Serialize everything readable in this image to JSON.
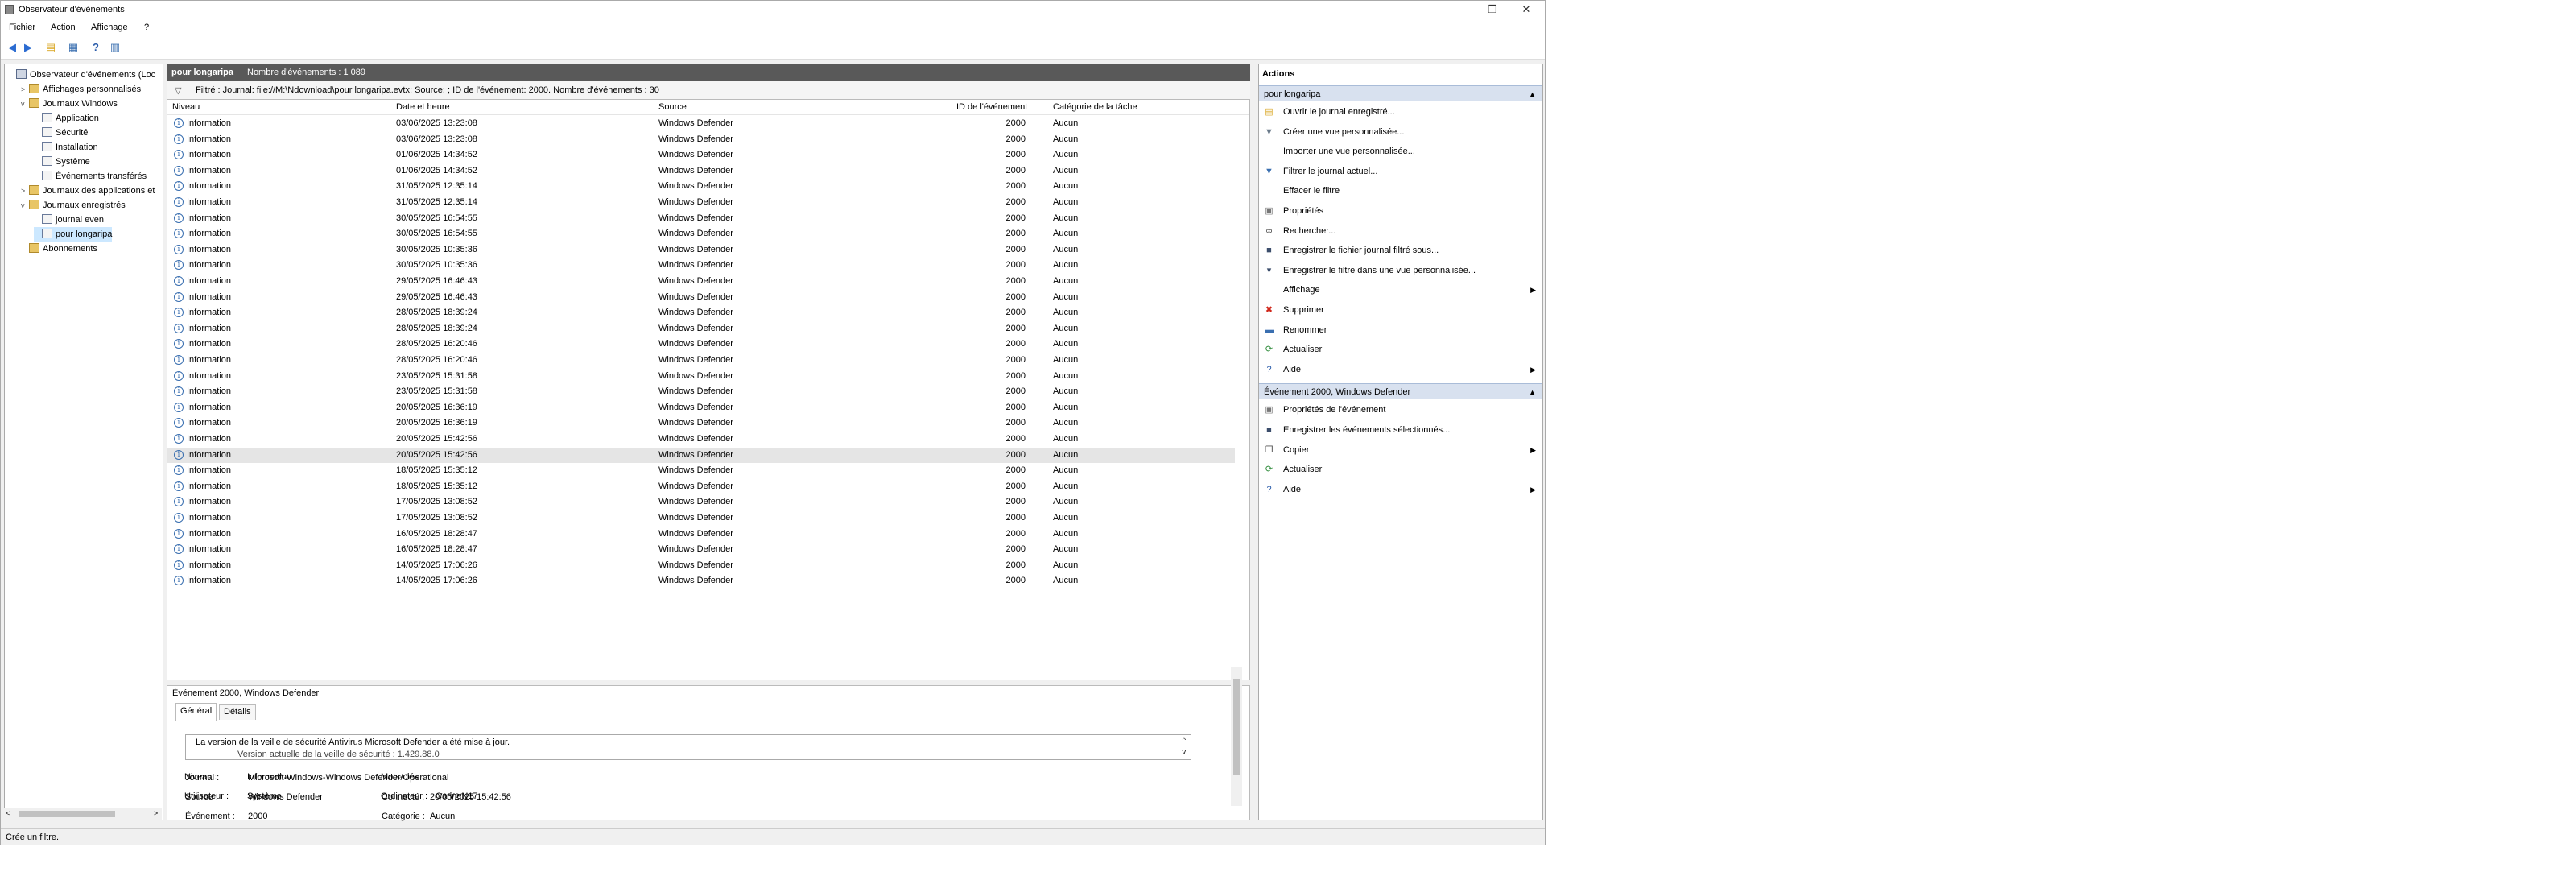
{
  "window": {
    "title": "Observateur d'événements"
  },
  "menu": [
    "Fichier",
    "Action",
    "Affichage",
    "?"
  ],
  "tree": [
    {
      "label": "Observateur d'événements (Loc",
      "level": 0,
      "exp": "",
      "icon": "root"
    },
    {
      "label": "Affichages personnalisés",
      "level": 1,
      "exp": ">",
      "icon": "folder"
    },
    {
      "label": "Journaux Windows",
      "level": 1,
      "exp": "v",
      "icon": "folder"
    },
    {
      "label": "Application",
      "level": 2,
      "exp": "",
      "icon": "log"
    },
    {
      "label": "Sécurité",
      "level": 2,
      "exp": "",
      "icon": "log"
    },
    {
      "label": "Installation",
      "level": 2,
      "exp": "",
      "icon": "log"
    },
    {
      "label": "Système",
      "level": 2,
      "exp": "",
      "icon": "log"
    },
    {
      "label": "Événements transférés",
      "level": 2,
      "exp": "",
      "icon": "log"
    },
    {
      "label": "Journaux des applications et",
      "level": 1,
      "exp": ">",
      "icon": "folder"
    },
    {
      "label": "Journaux enregistrés",
      "level": 1,
      "exp": "v",
      "icon": "folder"
    },
    {
      "label": "journal even",
      "level": 2,
      "exp": "",
      "icon": "log"
    },
    {
      "label": "pour longaripa",
      "level": 2,
      "exp": "",
      "icon": "log",
      "selected": true
    },
    {
      "label": "Abonnements",
      "level": 1,
      "exp": "",
      "icon": "folder"
    }
  ],
  "panel": {
    "name": "pour longaripa",
    "count": "Nombre d'événements : 1 089",
    "filter": "Filtré : Journal: file://M:\\Ndownload\\pour longaripa.evtx; Source: ; ID de l'événement: 2000. Nombre d'événements : 30"
  },
  "columns": [
    "Niveau",
    "Date et heure",
    "Source",
    "ID de l'événement",
    "Catégorie de la tâche"
  ],
  "events": [
    {
      "level": "Information",
      "date": "03/06/2025 13:23:08",
      "source": "Windows Defender",
      "id": "2000",
      "category": "Aucun"
    },
    {
      "level": "Information",
      "date": "03/06/2025 13:23:08",
      "source": "Windows Defender",
      "id": "2000",
      "category": "Aucun"
    },
    {
      "level": "Information",
      "date": "01/06/2025 14:34:52",
      "source": "Windows Defender",
      "id": "2000",
      "category": "Aucun"
    },
    {
      "level": "Information",
      "date": "01/06/2025 14:34:52",
      "source": "Windows Defender",
      "id": "2000",
      "category": "Aucun"
    },
    {
      "level": "Information",
      "date": "31/05/2025 12:35:14",
      "source": "Windows Defender",
      "id": "2000",
      "category": "Aucun"
    },
    {
      "level": "Information",
      "date": "31/05/2025 12:35:14",
      "source": "Windows Defender",
      "id": "2000",
      "category": "Aucun"
    },
    {
      "level": "Information",
      "date": "30/05/2025 16:54:55",
      "source": "Windows Defender",
      "id": "2000",
      "category": "Aucun"
    },
    {
      "level": "Information",
      "date": "30/05/2025 16:54:55",
      "source": "Windows Defender",
      "id": "2000",
      "category": "Aucun"
    },
    {
      "level": "Information",
      "date": "30/05/2025 10:35:36",
      "source": "Windows Defender",
      "id": "2000",
      "category": "Aucun"
    },
    {
      "level": "Information",
      "date": "30/05/2025 10:35:36",
      "source": "Windows Defender",
      "id": "2000",
      "category": "Aucun"
    },
    {
      "level": "Information",
      "date": "29/05/2025 16:46:43",
      "source": "Windows Defender",
      "id": "2000",
      "category": "Aucun"
    },
    {
      "level": "Information",
      "date": "29/05/2025 16:46:43",
      "source": "Windows Defender",
      "id": "2000",
      "category": "Aucun"
    },
    {
      "level": "Information",
      "date": "28/05/2025 18:39:24",
      "source": "Windows Defender",
      "id": "2000",
      "category": "Aucun"
    },
    {
      "level": "Information",
      "date": "28/05/2025 18:39:24",
      "source": "Windows Defender",
      "id": "2000",
      "category": "Aucun"
    },
    {
      "level": "Information",
      "date": "28/05/2025 16:20:46",
      "source": "Windows Defender",
      "id": "2000",
      "category": "Aucun"
    },
    {
      "level": "Information",
      "date": "28/05/2025 16:20:46",
      "source": "Windows Defender",
      "id": "2000",
      "category": "Aucun"
    },
    {
      "level": "Information",
      "date": "23/05/2025 15:31:58",
      "source": "Windows Defender",
      "id": "2000",
      "category": "Aucun"
    },
    {
      "level": "Information",
      "date": "23/05/2025 15:31:58",
      "source": "Windows Defender",
      "id": "2000",
      "category": "Aucun"
    },
    {
      "level": "Information",
      "date": "20/05/2025 16:36:19",
      "source": "Windows Defender",
      "id": "2000",
      "category": "Aucun"
    },
    {
      "level": "Information",
      "date": "20/05/2025 16:36:19",
      "source": "Windows Defender",
      "id": "2000",
      "category": "Aucun"
    },
    {
      "level": "Information",
      "date": "20/05/2025 15:42:56",
      "source": "Windows Defender",
      "id": "2000",
      "category": "Aucun"
    },
    {
      "level": "Information",
      "date": "20/05/2025 15:42:56",
      "source": "Windows Defender",
      "id": "2000",
      "category": "Aucun",
      "selected": true
    },
    {
      "level": "Information",
      "date": "18/05/2025 15:35:12",
      "source": "Windows Defender",
      "id": "2000",
      "category": "Aucun"
    },
    {
      "level": "Information",
      "date": "18/05/2025 15:35:12",
      "source": "Windows Defender",
      "id": "2000",
      "category": "Aucun"
    },
    {
      "level": "Information",
      "date": "17/05/2025 13:08:52",
      "source": "Windows Defender",
      "id": "2000",
      "category": "Aucun"
    },
    {
      "level": "Information",
      "date": "17/05/2025 13:08:52",
      "source": "Windows Defender",
      "id": "2000",
      "category": "Aucun"
    },
    {
      "level": "Information",
      "date": "16/05/2025 18:28:47",
      "source": "Windows Defender",
      "id": "2000",
      "category": "Aucun"
    },
    {
      "level": "Information",
      "date": "16/05/2025 18:28:47",
      "source": "Windows Defender",
      "id": "2000",
      "category": "Aucun"
    },
    {
      "level": "Information",
      "date": "14/05/2025 17:06:26",
      "source": "Windows Defender",
      "id": "2000",
      "category": "Aucun"
    },
    {
      "level": "Information",
      "date": "14/05/2025 17:06:26",
      "source": "Windows Defender",
      "id": "2000",
      "category": "Aucun"
    }
  ],
  "details": {
    "title": "Événement 2000, Windows Defender",
    "tabs": [
      "Général",
      "Détails"
    ],
    "message": "La version de la veille de sécurité Antivirus Microsoft Defender a été mise à jour.",
    "message2": "Version actuelle de la veille de sécurité : 1.429.88.0",
    "fields": {
      "journal_label": "Journal :",
      "journal_value": "Microsoft-Windows-Windows Defender/Operational",
      "source_label": "Source :",
      "source_value": "Windows Defender",
      "connecte_label": "Connecté :",
      "connecte_value": "20/05/2025 15:42:56",
      "evenement_label": "Événement :",
      "evenement_value": "2000",
      "categorie_label": "Catégorie :",
      "categorie_value": "Aucun",
      "niveau_label": "Niveau :",
      "niveau_value": "Information",
      "motscles_label": "Mots-clés :",
      "motscles_value": "",
      "utilisateur_label": "Utilisateur :",
      "utilisateur_value": "Système",
      "ordinateur_label": "Ordinateur :",
      "ordinateur_value": "CarineN17"
    }
  },
  "actions": {
    "title": "Actions",
    "section1": "pour longaripa",
    "items1": [
      {
        "label": "Ouvrir le journal enregistré...",
        "icon": "folder-open-icon",
        "glyph": "▤",
        "color": "#d9a520"
      },
      {
        "label": "Créer une vue personnalisée...",
        "icon": "funnel-star-icon",
        "glyph": "▼",
        "color": "#6a7a8a"
      },
      {
        "label": "Importer une vue personnalisée...",
        "icon": "",
        "glyph": "",
        "color": "#000"
      },
      {
        "label": "Filtrer le journal actuel...",
        "icon": "funnel-icon",
        "glyph": "▼",
        "color": "#3a6fb0"
      },
      {
        "label": "Effacer le filtre",
        "icon": "",
        "glyph": "",
        "color": "#000"
      },
      {
        "label": "Propriétés",
        "icon": "properties-icon",
        "glyph": "▣",
        "color": "#777"
      },
      {
        "label": "Rechercher...",
        "icon": "binoculars-icon",
        "glyph": "∞",
        "color": "#444"
      },
      {
        "label": "Enregistrer le fichier journal filtré sous...",
        "icon": "save-icon",
        "glyph": "■",
        "color": "#3b4d6b"
      },
      {
        "label": "Enregistrer le filtre dans une vue personnalisée...",
        "icon": "save-filter-icon",
        "glyph": "▾",
        "color": "#3b4d6b"
      },
      {
        "label": "Affichage",
        "icon": "",
        "glyph": "",
        "color": "#000",
        "sub": true
      },
      {
        "label": "Supprimer",
        "icon": "delete-icon",
        "glyph": "✖",
        "color": "#d0261a"
      },
      {
        "label": "Renommer",
        "icon": "rename-icon",
        "glyph": "▬",
        "color": "#3a6fb0"
      },
      {
        "label": "Actualiser",
        "icon": "refresh-icon",
        "glyph": "⟳",
        "color": "#2e8b3a"
      },
      {
        "label": "Aide",
        "icon": "help-icon",
        "glyph": "?",
        "color": "#2a5caa",
        "sub": true
      }
    ],
    "section2": "Événement 2000, Windows Defender",
    "items2": [
      {
        "label": "Propriétés de l'événement",
        "icon": "properties-icon",
        "glyph": "▣",
        "color": "#777"
      },
      {
        "label": "Enregistrer les événements sélectionnés...",
        "icon": "save-icon",
        "glyph": "■",
        "color": "#3b4d6b"
      },
      {
        "label": "Copier",
        "icon": "copy-icon",
        "glyph": "❐",
        "color": "#555",
        "sub": true
      },
      {
        "label": "Actualiser",
        "icon": "refresh-icon",
        "glyph": "⟳",
        "color": "#2e8b3a"
      },
      {
        "label": "Aide",
        "icon": "help-icon",
        "glyph": "?",
        "color": "#2a5caa",
        "sub": true
      }
    ]
  },
  "status": "Crée un filtre."
}
